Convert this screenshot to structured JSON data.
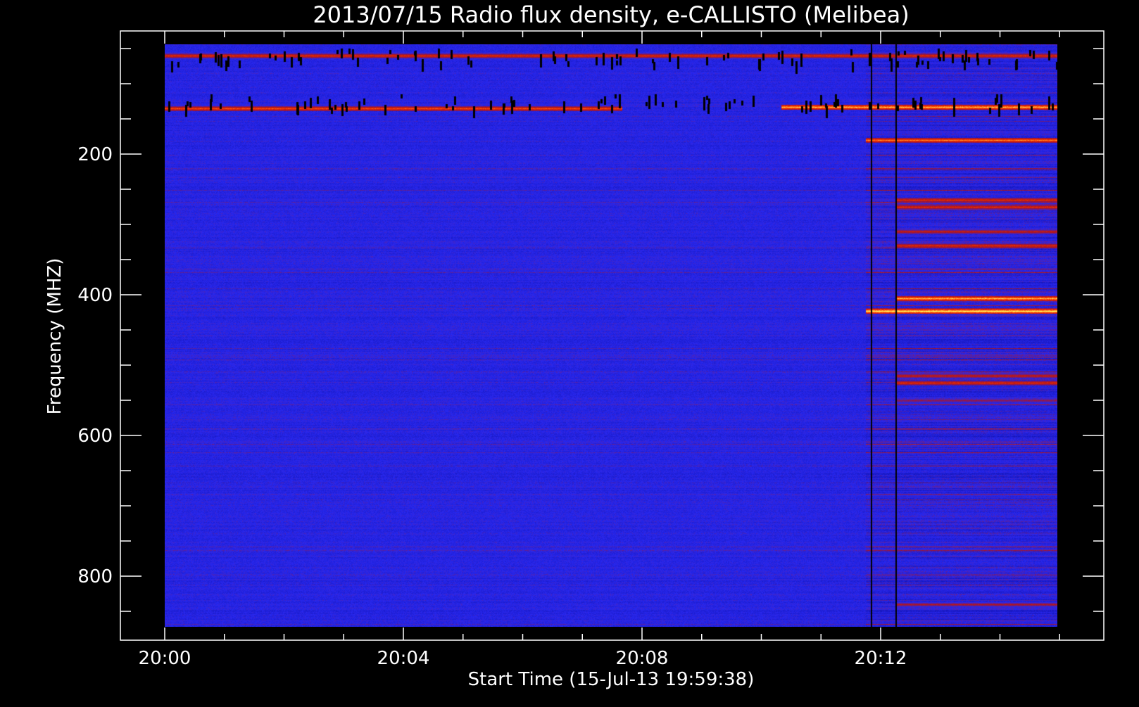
{
  "chart_data": {
    "type": "heatmap",
    "title": "2013/07/15  Radio flux density, e-CALLISTO (Melibea)",
    "xlabel": "Start Time (15-Jul-13 19:59:38)",
    "ylabel": "Frequency (MHZ)",
    "x_ticks": [
      "20:00",
      "20:04",
      "20:08",
      "20:12"
    ],
    "y_ticks": [
      "200",
      "400",
      "600",
      "800"
    ],
    "y_axis_inverted": true,
    "y_range_mhz": [
      45,
      870
    ],
    "x_range": [
      "20:00",
      "20:14:58"
    ],
    "colormap": [
      "#000000",
      "#1414b4",
      "#2828f0",
      "#b41414",
      "#ff3c00",
      "#ffff64"
    ],
    "bright_bands_mhz": [
      {
        "freq": 60,
        "intensity": 0.8,
        "start": "20:00",
        "end": "20:14:58"
      },
      {
        "freq": 135,
        "intensity": 0.85,
        "start": "20:00",
        "end": "20:07:40"
      },
      {
        "freq": 133,
        "intensity": 0.95,
        "start": "20:10:20",
        "end": "20:14:58"
      },
      {
        "freq": 180,
        "intensity": 0.9,
        "start": "20:11:45",
        "end": "20:14:58"
      },
      {
        "freq": 265,
        "intensity": 0.8,
        "start": "20:12:15",
        "end": "20:14:58"
      },
      {
        "freq": 275,
        "intensity": 0.8,
        "start": "20:12:15",
        "end": "20:14:58"
      },
      {
        "freq": 310,
        "intensity": 0.75,
        "start": "20:12:15",
        "end": "20:14:58"
      },
      {
        "freq": 330,
        "intensity": 0.8,
        "start": "20:12:15",
        "end": "20:14:58"
      },
      {
        "freq": 405,
        "intensity": 0.95,
        "start": "20:12:15",
        "end": "20:14:58"
      },
      {
        "freq": 423,
        "intensity": 1.0,
        "start": "20:11:45",
        "end": "20:14:58"
      },
      {
        "freq": 515,
        "intensity": 0.75,
        "start": "20:12:15",
        "end": "20:14:58"
      },
      {
        "freq": 525,
        "intensity": 0.8,
        "start": "20:12:15",
        "end": "20:14:58"
      },
      {
        "freq": 550,
        "intensity": 0.65,
        "start": "20:12:15",
        "end": "20:14:58"
      },
      {
        "freq": 840,
        "intensity": 0.7,
        "start": "20:12:15",
        "end": "20:14:58"
      }
    ],
    "dark_vertical_lines": [
      "20:11:50",
      "20:12:15"
    ]
  }
}
